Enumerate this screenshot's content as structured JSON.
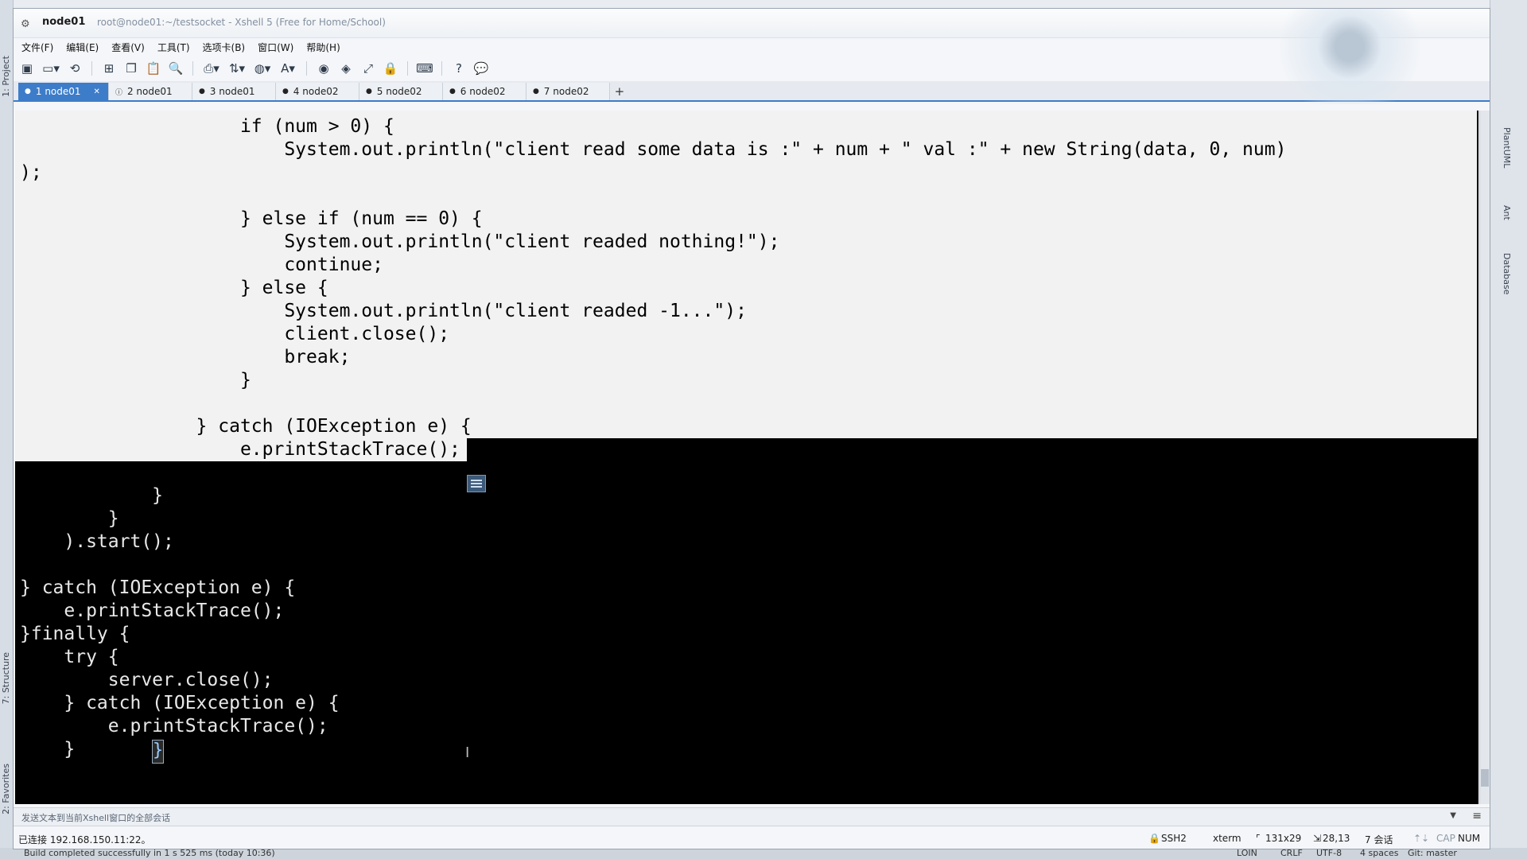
{
  "ide": {
    "left_tabs": [
      "1: Project",
      "7: Structure",
      "2: Favorites"
    ],
    "right_tabs": [
      "PlantUML",
      "Ant",
      "Database"
    ],
    "bottom_left": "Build completed successfully in 1 s 525 ms (today 10:36)",
    "bottom_right": [
      "LOIN",
      "CRLF",
      "UTF-8",
      "4 spaces",
      "Git: master"
    ]
  },
  "window": {
    "title_main": "node01",
    "title_sub": "root@node01:~/testsocket - Xshell 5 (Free for Home/School)"
  },
  "menu": [
    "文件(F)",
    "编辑(E)",
    "查看(V)",
    "工具(T)",
    "选项卡(B)",
    "窗口(W)",
    "帮助(H)"
  ],
  "toolbar": {
    "icons": [
      "new-session-icon",
      "open-folder-icon",
      "reconnect-icon",
      "properties-icon",
      "copy-icon",
      "paste-icon",
      "find-icon",
      "print-icon",
      "transfer-icon",
      "globe-icon",
      "font-icon",
      "xftp-icon",
      "xmanager-icon",
      "fullscreen-icon",
      "lock-icon",
      "keyboard-icon",
      "help-icon",
      "chat-icon"
    ]
  },
  "tabs": [
    {
      "num": "1",
      "label": "node01",
      "active": true
    },
    {
      "num": "2",
      "label": "node01",
      "active": false
    },
    {
      "num": "3",
      "label": "node01",
      "active": false
    },
    {
      "num": "4",
      "label": "node02",
      "active": false
    },
    {
      "num": "5",
      "label": "node02",
      "active": false
    },
    {
      "num": "6",
      "label": "node02",
      "active": false
    },
    {
      "num": "7",
      "label": "node02",
      "active": false
    }
  ],
  "terminal": {
    "lines": [
      "                    if (num > 0) {",
      "                        System.out.println(\"client read some data is :\" + num + \" val :\" + new String(data, 0, num)",
      ");",
      "",
      "                    } else if (num == 0) {",
      "                        System.out.println(\"client readed nothing!\");",
      "                        continue;",
      "                    } else {",
      "                        System.out.println(\"client readed -1...\");",
      "                        client.close();",
      "                        break;",
      "                    }",
      "",
      "                } catch (IOException e) {",
      "                    e.printStackTrace();",
      "                }",
      "            }",
      "        }",
      "    ).start();",
      "",
      "} catch (IOException e) {",
      "    e.printStackTrace();",
      "}finally {",
      "    try {",
      "        server.close();",
      "    } catch (IOException e) {",
      "        e.printStackTrace();",
      "    }",
      "}"
    ],
    "cursor_char": "}"
  },
  "sendbar": {
    "text": "发送文本到当前Xshell窗口的全部会话"
  },
  "status": {
    "connection": "已连接 192.168.150.11:22。",
    "protocol": "SSH2",
    "term": "xterm",
    "size": "131x29",
    "pos": "28,13",
    "sessions": "7 会话",
    "caps": "CAP",
    "num": "NUM"
  }
}
